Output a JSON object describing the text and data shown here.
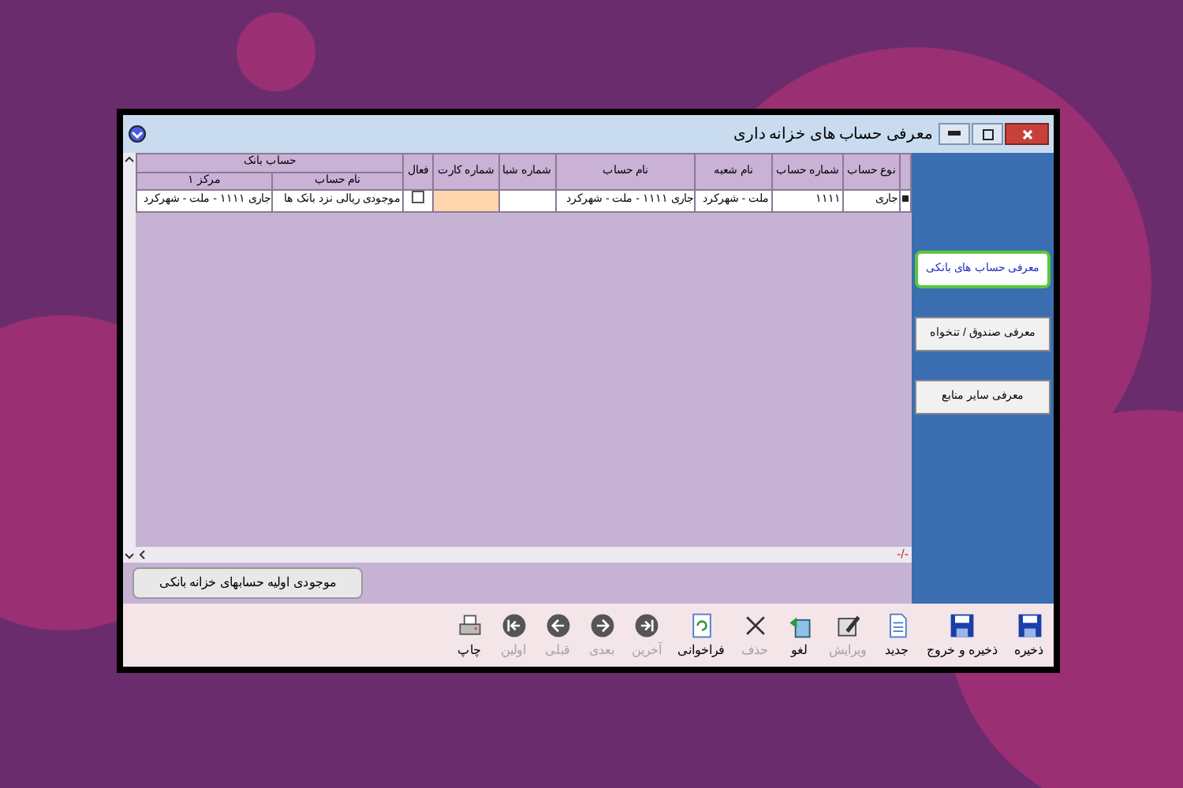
{
  "window": {
    "title": "معرفی حساب های خزانه داری"
  },
  "table": {
    "group_header": "حساب بانک",
    "columns": [
      {
        "label": "نوع حساب"
      },
      {
        "label": "شماره حساب"
      },
      {
        "label": "نام شعبه"
      },
      {
        "label": "نام حساب"
      },
      {
        "label": "شماره شبا"
      },
      {
        "label": "شماره کارت"
      },
      {
        "label": "فعال"
      }
    ],
    "group_columns": [
      {
        "label": "نام حساب"
      },
      {
        "label": "مرکز ۱"
      }
    ],
    "rows": [
      {
        "selected": true,
        "cells": [
          "جاری",
          "۱۱۱۱",
          "ملت - شهرکرد",
          "جاری ۱۱۱۱ - ملت - شهرکرد",
          "",
          ""
        ],
        "active": false,
        "group_cells": [
          "موجودی ریالی نزد بانک ها",
          "جاری ۱۱۱۱ - ملت - شهرکرد"
        ]
      }
    ],
    "footer": "-/-"
  },
  "side_buttons": [
    {
      "label": "معرفی حساب های بانکی",
      "selected": true
    },
    {
      "label": "معرفی صندوق / تنخواه",
      "selected": false
    },
    {
      "label": "معرفی سایر منابع",
      "selected": false
    }
  ],
  "bottom_button": "موجودی اولیه حسابهای خزانه بانکی",
  "toolbar": [
    {
      "kind": "save",
      "label": "ذخیره",
      "disabled": false
    },
    {
      "kind": "save",
      "label": "ذخیره و خروج",
      "disabled": false
    },
    {
      "kind": "new",
      "label": "جدید",
      "disabled": false
    },
    {
      "kind": "edit",
      "label": "ویرایش",
      "disabled": true
    },
    {
      "kind": "undo",
      "label": "لغو",
      "disabled": false
    },
    {
      "kind": "delete",
      "label": "حذف",
      "disabled": true
    },
    {
      "kind": "refresh",
      "label": "فراخوانی",
      "disabled": false
    },
    {
      "kind": "last",
      "label": "آخرین",
      "disabled": true
    },
    {
      "kind": "next",
      "label": "بعدی",
      "disabled": true
    },
    {
      "kind": "prev",
      "label": "قبلی",
      "disabled": true
    },
    {
      "kind": "first",
      "label": "اولین",
      "disabled": true
    },
    {
      "kind": "print",
      "label": "چاپ",
      "disabled": false
    }
  ]
}
